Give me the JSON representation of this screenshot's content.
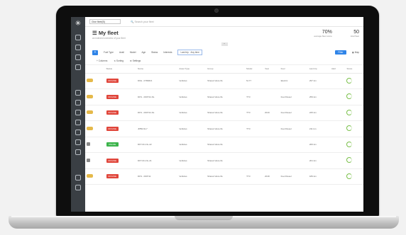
{
  "app": {
    "fleet_selector": "Give fleet(B)",
    "search_placeholder": "Search your fleet",
    "title": "My fleet",
    "subtitle": "an indexed overview of your fleet",
    "kpis": [
      {
        "value": "70%",
        "label": "average fleet score"
      },
      {
        "value": "50",
        "label": "total fleet"
      }
    ]
  },
  "filters": {
    "add_label": "+",
    "chips": [
      "Fuel Type",
      "Avail",
      "Model",
      "Age",
      "Status",
      "Interests"
    ],
    "active_chip": "Last trip · Any time",
    "primary_button": "Filter",
    "map_button": "Map"
  },
  "actions": [
    "Columns",
    "Sorting",
    "Settings"
  ],
  "table": {
    "columns": [
      "",
      "Status",
      "Name",
      "Asset Type",
      "Group",
      "Model",
      "Year",
      "Fuel",
      "Last trip",
      "Alert",
      "Score"
    ],
    "rows": [
      {
        "icon": "car",
        "status_color": "#e0453a",
        "status": "OFFLINE",
        "name": "DFE - 0783821",
        "type": "Vehicles",
        "group": "Shared Vans-NL",
        "model": "M-77",
        "year": "",
        "fuel": "Electric",
        "last_trip": "297 km",
        "alert": ""
      },
      {
        "icon": "car",
        "status_color": "#e0453a",
        "status": "OFFLINE",
        "name": "DFS - 000734-NL",
        "type": "Vehicles",
        "group": "Shared Vans-NL",
        "model": "TT3",
        "year": "",
        "fuel": "Fuel Diesel",
        "last_trip": "259 km",
        "alert": ""
      },
      {
        "icon": "car",
        "status_color": "#e0453a",
        "status": "OFFLINE",
        "name": "DFS - 000734-NL",
        "type": "Vehicles",
        "group": "Shared Vans-NL",
        "model": "TT3",
        "year": "2019",
        "fuel": "Fuel Diesel",
        "last_trip": "225 km",
        "alert": ""
      },
      {
        "icon": "car",
        "status_color": "#e0453a",
        "status": "OFFLINE",
        "name": "JPB6-NL7",
        "type": "Vehicles",
        "group": "Shared Vans-NL",
        "model": "TT3",
        "year": "",
        "fuel": "Fuel Diesel",
        "last_trip": "211 km",
        "alert": ""
      },
      {
        "icon": "key",
        "status_color": "#3cb44b",
        "status": "ONLINE",
        "name": "DFT-6C-NL-22",
        "type": "Vehicles",
        "group": "Shared Vans-NL",
        "model": "",
        "year": "",
        "fuel": "",
        "last_trip": "206 km",
        "alert": ""
      },
      {
        "icon": "key",
        "status_color": "#e0453a",
        "status": "OFFLINE",
        "name": "DFT-6C-NL-21",
        "type": "Vehicles",
        "group": "Shared Vans-NL",
        "model": "",
        "year": "",
        "fuel": "",
        "last_trip": "201 km",
        "alert": ""
      },
      {
        "icon": "car",
        "status_color": "#e0453a",
        "status": "OFFLINE",
        "name": "DFS - 000711",
        "type": "Vehicles",
        "group": "Shared Vans-NL",
        "model": "TT3",
        "year": "2018",
        "fuel": "Fuel Diesel",
        "last_trip": "189 km",
        "alert": ""
      }
    ]
  }
}
